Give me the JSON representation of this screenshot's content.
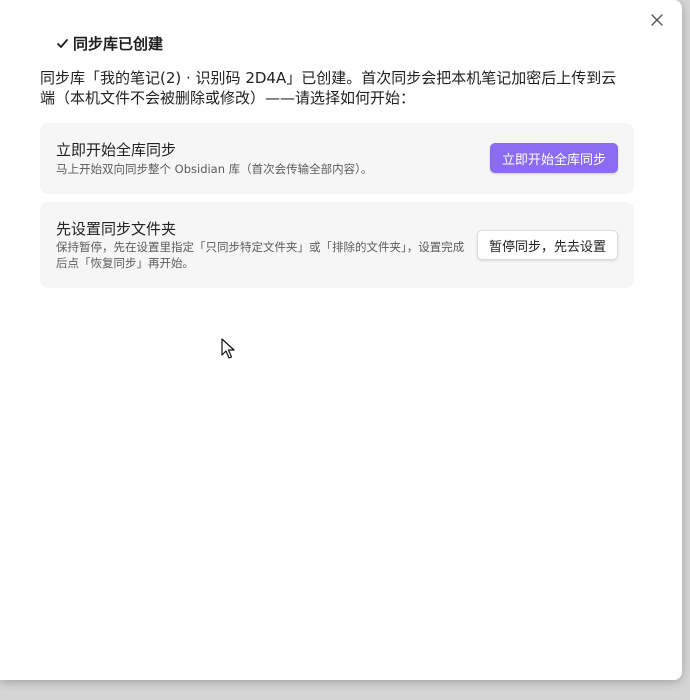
{
  "modal": {
    "title": "同步库已创建",
    "description": "同步库「我的笔记(2) · 识别码 2D4A」已创建。首次同步会把本机笔记加密后上传到云端（本机文件不会被删除或修改）——请选择如何开始：",
    "close_icon": "close-icon",
    "check_icon": "check-icon"
  },
  "options": [
    {
      "title": "立即开始全库同步",
      "description": "马上开始双向同步整个 Obsidian 库（首次会传输全部内容）。",
      "button_label": "立即开始全库同步"
    },
    {
      "title": "先设置同步文件夹",
      "description": "保持暂停，先在设置里指定「只同步特定文件夹」或「排除的文件夹」，设置完成后点「恢复同步」再开始。",
      "button_label": "暂停同步，先去设置"
    }
  ],
  "colors": {
    "accent": "#8b6cf0",
    "card_bg": "#f6f6f6",
    "text": "#222222",
    "muted_text": "#5c5c5c"
  }
}
